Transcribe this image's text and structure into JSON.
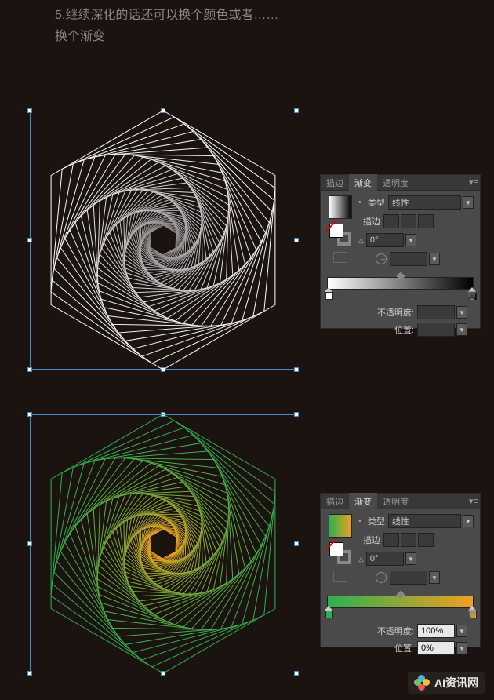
{
  "instruction": {
    "line1": "5.继续深化的话还可以换个颜色或者……",
    "line2": "换个渐变"
  },
  "panel": {
    "tabs": {
      "stroke": "描边",
      "gradient": "渐变",
      "transparency": "透明度"
    },
    "type_label": "类型",
    "type_value": "线性",
    "stroke_label": "描边",
    "angle_value": "0°",
    "aspect_value": "",
    "opacity_label": "不透明度:",
    "position_label": "位置:",
    "opacity_value_blank": "",
    "position_value_blank": "",
    "opacity_value": "100%",
    "position_value": "0%"
  },
  "watermark": {
    "text": "AI资讯网"
  }
}
